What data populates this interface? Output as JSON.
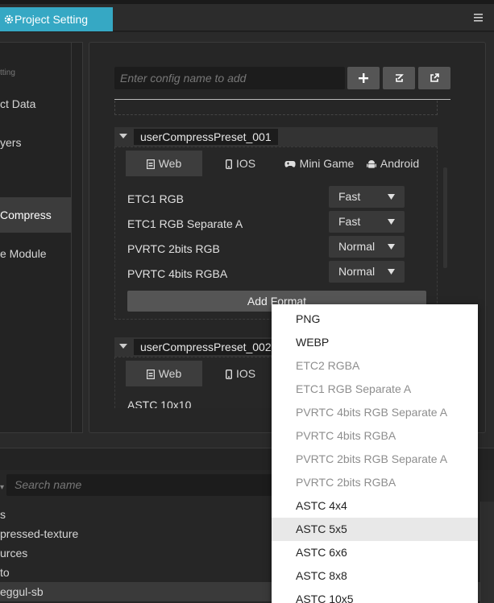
{
  "tab": {
    "label": "Project Setting",
    "icon": "gear-icon"
  },
  "sidebar": {
    "items": [
      {
        "label": "tting"
      },
      {
        "label": "ct Data"
      },
      {
        "label": "yers"
      },
      {
        "label": "Compress"
      },
      {
        "label": "e Module"
      }
    ]
  },
  "config": {
    "placeholder": "Enter config name to add"
  },
  "presets": [
    {
      "name": "userCompressPreset_001",
      "platforms": [
        {
          "label": "Web",
          "icon": "web-icon",
          "active": true
        },
        {
          "label": "IOS",
          "icon": "phone-icon"
        },
        {
          "label": "Mini Game",
          "icon": "gamepad-icon"
        },
        {
          "label": "Android",
          "icon": "android-icon"
        }
      ],
      "formats": [
        {
          "label": "ETC1 RGB",
          "quality": "Fast"
        },
        {
          "label": "ETC1 RGB Separate A",
          "quality": "Fast"
        },
        {
          "label": "PVRTC 2bits RGB",
          "quality": "Normal"
        },
        {
          "label": "PVRTC 4bits RGBA",
          "quality": "Normal"
        }
      ],
      "add_format_label": "Add Format"
    },
    {
      "name": "userCompressPreset_002",
      "platforms": [
        {
          "label": "Web",
          "icon": "web-icon",
          "active": true
        },
        {
          "label": "IOS",
          "icon": "phone-icon"
        }
      ],
      "formats": [
        {
          "label": "ASTC 10x10"
        }
      ]
    }
  ],
  "assets": {
    "search_placeholder": "Search name",
    "items": [
      {
        "label": "s"
      },
      {
        "label": "pressed-texture"
      },
      {
        "label": "urces"
      },
      {
        "label": "to"
      },
      {
        "label": "eggul-sb",
        "selected": true
      }
    ]
  },
  "dropdown": {
    "items": [
      {
        "label": "PNG",
        "enabled": true
      },
      {
        "label": "WEBP",
        "enabled": true
      },
      {
        "label": "ETC2 RGBA",
        "enabled": false
      },
      {
        "label": "ETC1 RGB Separate A",
        "enabled": false
      },
      {
        "label": "PVRTC 4bits RGB Separate A",
        "enabled": false
      },
      {
        "label": "PVRTC 4bits RGBA",
        "enabled": false
      },
      {
        "label": "PVRTC 2bits RGB Separate A",
        "enabled": false
      },
      {
        "label": "PVRTC 2bits RGBA",
        "enabled": false
      },
      {
        "label": "ASTC 4x4",
        "enabled": true
      },
      {
        "label": "ASTC 5x5",
        "enabled": true,
        "hovered": true
      },
      {
        "label": "ASTC 6x6",
        "enabled": true
      },
      {
        "label": "ASTC 8x8",
        "enabled": true
      },
      {
        "label": "ASTC 10x5",
        "enabled": true
      }
    ]
  },
  "colors": {
    "accent": "#36a8c4",
    "background": "#222222",
    "panel": "#262626"
  }
}
